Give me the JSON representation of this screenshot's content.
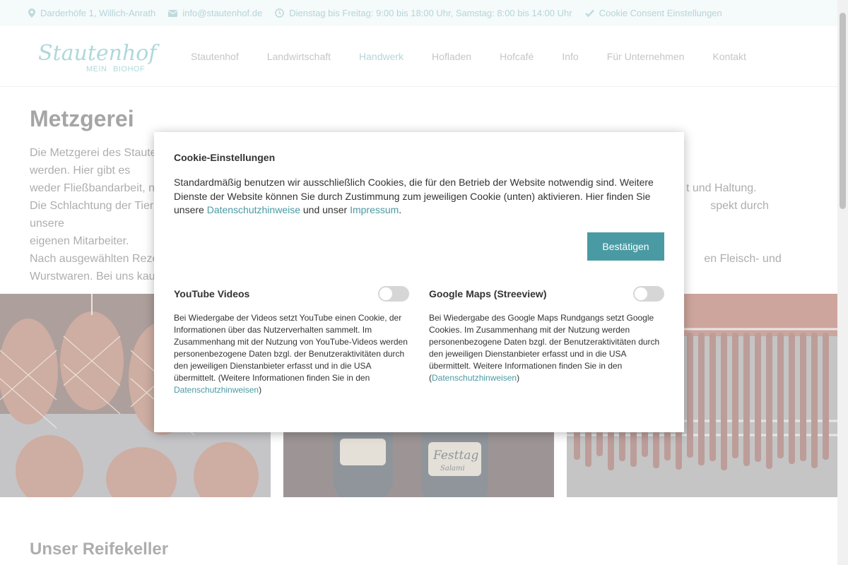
{
  "topbar": {
    "address": "Darderhöfe 1, Willich-Anrath",
    "email": "info@stautenhof.de",
    "hours": "Dienstag bis Freitag: 9:00 bis 18:00 Uhr, Samstag: 8:00 bis 14:00 Uhr",
    "cookie_link": "Cookie Consent Einstellungen"
  },
  "logo": {
    "script": "Stautenhof",
    "tagline_1": "MEIN",
    "tagline_2": "BIOHOF"
  },
  "nav": [
    {
      "label": "Stautenhof"
    },
    {
      "label": "Landwirtschaft"
    },
    {
      "label": "Handwerk"
    },
    {
      "label": "Hofladen"
    },
    {
      "label": "Hofcafé"
    },
    {
      "label": "Info"
    },
    {
      "label": "Für Unternehmen"
    },
    {
      "label": "Kontakt"
    }
  ],
  "content": {
    "title": "Metzgerei",
    "p1_start": "Die Metzgerei des Stautenhofs",
    "p1_end": "werden. Hier gibt es",
    "p2_start": "weder Fließbandarbeit, n",
    "p2_end": "t und Haltung.",
    "p3_start": "Die Schlachtung der Tier",
    "p3_end": "spekt durch unsere",
    "p4": "eigenen Mitarbeiter.",
    "p5_start": "Nach ausgewählten Reze",
    "p5_end": "en Fleisch- und",
    "p6_start": "Wurstwaren. Bei uns kau"
  },
  "gallery": {
    "salami_label_1": "Festtag",
    "salami_label_2": "Salami"
  },
  "section2_title": "Unser Reifekeller",
  "modal": {
    "title": "Cookie-Einstellungen",
    "intro_1": "Standardmäßig benutzen wir ausschließlich Cookies, die für den Betrieb der Website notwendig sind. Weitere Dienste der Website können Sie durch Zustimmung zum jeweiligen Cookie (unten) aktivieren. Hier finden Sie unsere ",
    "privacy_link": "Datenschutzhinweise",
    "intro_2": " und unser ",
    "imprint_link": "Impressum",
    "intro_3": ".",
    "confirm_label": "Bestätigen",
    "youtube": {
      "title": "YouTube Videos",
      "enabled": false,
      "text": "Bei Wiedergabe der Videos setzt YouTube einen Cookie, der Informationen über das Nutzerverhalten sammelt. Im Zusammenhang mit der Nutzung von YouTube-Videos werden personenbezogene Daten bzgl. der Benutzeraktivitäten durch den jeweiligen Dienstanbieter erfasst und in die USA übermittelt. (Weitere Informationen finden Sie in den ",
      "link": "Datenschutzhinweisen",
      "close": ")"
    },
    "maps": {
      "title": "Google Maps (Streeview)",
      "enabled": false,
      "text": "Bei Wiedergabe des Google Maps Rundgangs setzt Google Cookies. Im Zusammenhang mit der Nutzung werden personenbezogene Daten bzgl. der Benutzeraktivitäten durch den jeweiligen Dienstanbieter erfasst und in die USA übermittelt. Weitere Informationen finden Sie in den ",
      "text_open": "(",
      "link": "Datenschutzhinweisen",
      "close": ")"
    }
  },
  "colors": {
    "accent": "#4a9aa3",
    "topbar_bg": "#eaf4f5",
    "topbar_text": "#6aaab1"
  }
}
